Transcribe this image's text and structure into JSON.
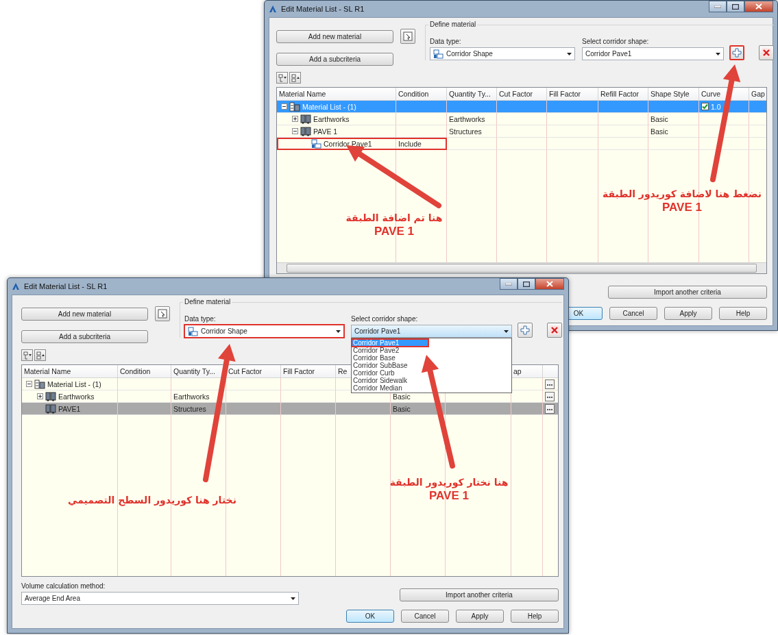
{
  "windows": [
    {
      "title": "Edit Material List - SL R1",
      "focused": true,
      "add_material": "Add new material",
      "add_subcriteria": "Add a subcriteria",
      "define_material": {
        "legend": "Define material",
        "data_type": {
          "label": "Data type:",
          "value": "Corridor Shape",
          "outlined": false
        },
        "corridor_shape": {
          "label": "Select corridor shape:",
          "value": "Corridor Pave1",
          "open": false,
          "add_outlined": true
        }
      },
      "columns": [
        {
          "label": "Material Name"
        },
        {
          "label": "Condition"
        },
        {
          "label": "Quantity Ty..."
        },
        {
          "label": "Cut Factor"
        },
        {
          "label": "Fill Factor"
        },
        {
          "label": "Refill Factor"
        },
        {
          "label": "Shape Style"
        },
        {
          "label": "Curve"
        },
        {
          "label": "Gap"
        }
      ],
      "rows": [
        {
          "kind": "list",
          "selected": true,
          "expanded": true,
          "cells": [
            "Material List - (1)",
            "",
            "",
            "",
            "",
            "",
            "",
            {
              "text": "1.0",
              "checked": true
            }
          ],
          "children": [
            {
              "kind": "material",
              "selected": false,
              "expanded": false,
              "cells": [
                "Earthworks",
                "",
                "Earthworks",
                "",
                "",
                "",
                "Basic"
              ]
            },
            {
              "kind": "material",
              "selected": false,
              "expanded": true,
              "cells": [
                "PAVE 1",
                "",
                "Structures",
                "",
                "",
                "",
                "Basic"
              ],
              "children": [
                {
                  "kind": "corridor",
                  "selected": false,
                  "outlined": true,
                  "cells": [
                    "Corridor Pave1",
                    "Include"
                  ]
                }
              ]
            }
          ]
        }
      ],
      "import_button": "Import another criteria",
      "dialog_buttons": [
        {
          "label": "OK",
          "default": true
        },
        {
          "label": "Cancel",
          "default": false
        },
        {
          "label": "Apply",
          "default": false
        },
        {
          "label": "Help",
          "default": false
        }
      ]
    },
    {
      "title": "Edit Material List - SL R1",
      "focused": false,
      "add_material": "Add new material",
      "add_subcriteria": "Add a subcriteria",
      "define_material": {
        "legend": "Define material",
        "data_type": {
          "label": "Data type:",
          "value": "Corridor Shape",
          "outlined": true
        },
        "corridor_shape": {
          "label": "Select corridor shape:",
          "value": "Corridor Pave1",
          "open": true,
          "add_outlined": false,
          "options": [
            {
              "label": "Corridor Pave1",
              "selected": true
            },
            {
              "label": "Corridor Pave2",
              "selected": false
            },
            {
              "label": "Corridor Base",
              "selected": false
            },
            {
              "label": "Corridor SubBase",
              "selected": false
            },
            {
              "label": "Corridor Curb",
              "selected": false
            },
            {
              "label": "Corridor Sidewalk",
              "selected": false
            },
            {
              "label": "Corridor Median",
              "selected": false
            }
          ]
        }
      },
      "columns": [
        {
          "label": "Material Name"
        },
        {
          "label": "Condition"
        },
        {
          "label": "Quantity Ty..."
        },
        {
          "label": "Cut Factor"
        },
        {
          "label": "Fill Factor"
        },
        {
          "label": "Re"
        },
        {},
        {},
        {
          "label": "ap"
        }
      ],
      "rows": [
        {
          "kind": "list",
          "selected": false,
          "expanded": true,
          "more_button": true,
          "cells": [
            "Material List - (1)"
          ],
          "children": [
            {
              "kind": "material",
              "selected": false,
              "expanded": false,
              "more_button": true,
              "cells": [
                "Earthworks",
                "",
                "Earthworks",
                "",
                "",
                "",
                "Basic"
              ]
            },
            {
              "kind": "material",
              "selected": true,
              "more_button": true,
              "cells": [
                "PAVE1",
                "",
                "Structures",
                "",
                "",
                "",
                "Basic"
              ]
            }
          ]
        }
      ],
      "volume": {
        "label": "Volume calculation method:",
        "value": "Average End Area"
      },
      "import_button": "Import another criteria",
      "dialog_buttons": [
        {
          "label": "OK",
          "default": true
        },
        {
          "label": "Cancel",
          "default": false
        },
        {
          "label": "Apply",
          "default": false
        },
        {
          "label": "Help",
          "default": false
        }
      ]
    }
  ],
  "annotations": [
    {
      "text": "هنا تم اضافة الطبقة",
      "subtext": "PAVE 1"
    },
    {
      "text": "نضغط هنا لاضافة كوريدور الطبقة",
      "subtext": "PAVE 1"
    },
    {
      "text": "نختار هنا كوريدور السطح التصميمي"
    },
    {
      "text": "هنا نختار كوريدور الطبقة",
      "subtext": "PAVE 1"
    }
  ]
}
